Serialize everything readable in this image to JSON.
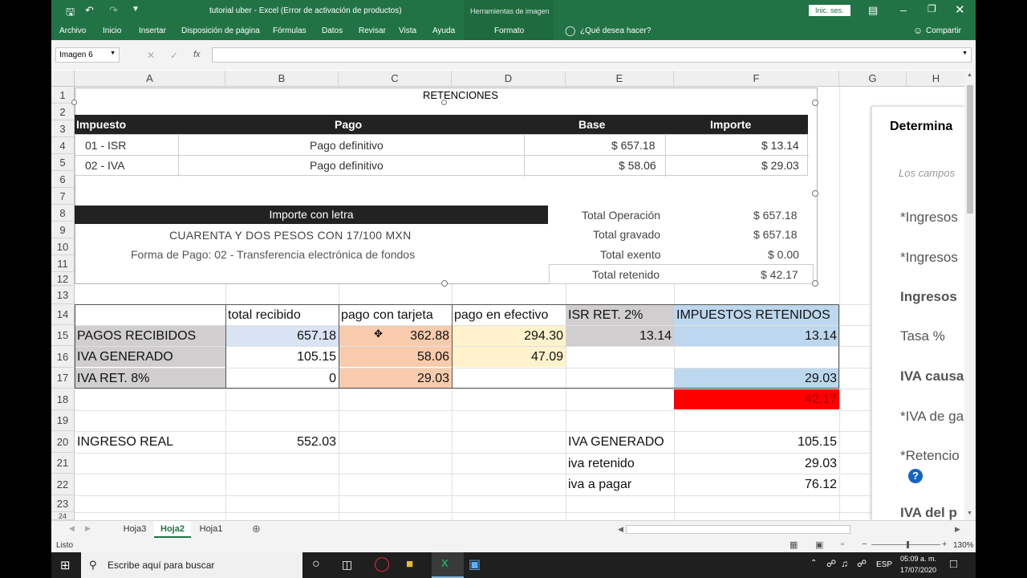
{
  "titlebar": {
    "doc_title": "tutorial uber  -  Excel (Error de activación de productos)",
    "context_tab": "Herramientas de imagen",
    "signin": "Inic. ses."
  },
  "ribbon": {
    "tabs": [
      "Archivo",
      "Inicio",
      "Insertar",
      "Disposición de página",
      "Fórmulas",
      "Datos",
      "Revisar",
      "Vista",
      "Ayuda"
    ],
    "context_tab": "Formato",
    "tell_me": "¿Qué desea hacer?",
    "share": "Compartir"
  },
  "formula_bar": {
    "name_box": "Imagen 6",
    "fx": "fx",
    "value": ""
  },
  "columns": [
    "A",
    "B",
    "C",
    "D",
    "E",
    "F",
    "G",
    "H"
  ],
  "rows": [
    "1",
    "2",
    "3",
    "4",
    "5",
    "6",
    "7",
    "8",
    "9",
    "10",
    "11",
    "12",
    "13",
    "14",
    "15",
    "16",
    "17",
    "18",
    "19",
    "20",
    "21",
    "22",
    "23",
    "24"
  ],
  "retenciones": {
    "title": "RETENCIONES",
    "headers": [
      "Impuesto",
      "Pago",
      "Base",
      "Importe"
    ],
    "rows": [
      [
        "01 - ISR",
        "Pago definitivo",
        "$ 657.18",
        "$ 13.14"
      ],
      [
        "02 - IVA",
        "Pago definitivo",
        "$ 58.06",
        "$ 29.03"
      ]
    ],
    "importe_letra_label": "Importe con letra",
    "importe_letra": "CUARENTA Y DOS PESOS CON 17/100 MXN",
    "forma_pago": "Forma de Pago: 02 - Transferencia electrónica de fondos",
    "totals": [
      [
        "Total Operación",
        "$ 657.18"
      ],
      [
        "Total gravado",
        "$ 657.18"
      ],
      [
        "Total exento",
        "$ 0.00"
      ],
      [
        "Total retenido",
        "$ 42.17"
      ]
    ]
  },
  "table": {
    "headers": [
      "total recibido",
      "pago con tarjeta",
      "pago en efectivo",
      "ISR RET. 2%",
      "IMPUESTOS RETENIDOS"
    ],
    "r15": [
      "PAGOS RECIBIDOS",
      "657.18",
      "362.88",
      "294.30",
      "13.14",
      "13.14"
    ],
    "r16": [
      "IVA GENERADO",
      "105.15",
      "58.06",
      "47.09"
    ],
    "r17": [
      "IVA RET. 8%",
      "0",
      "29.03",
      "29.03"
    ],
    "r18_total": "42.17",
    "r20": [
      "INGRESO REAL",
      "552.03",
      "IVA GENERADO",
      "105.15"
    ],
    "r21": [
      "iva retenido",
      "29.03"
    ],
    "r22": [
      "iva a pagar",
      "76.12"
    ]
  },
  "side_panel": {
    "title": "Determina",
    "note": "Los campos",
    "items": [
      "*Ingresos",
      "*Ingresos",
      "Ingresos",
      "Tasa %",
      "IVA causa",
      "*IVA de ga",
      "*Retencio",
      "IVA del p"
    ]
  },
  "sheets": [
    "Hoja3",
    "Hoja2",
    "Hoja1"
  ],
  "active_sheet": "Hoja2",
  "status": {
    "text": "Listo",
    "zoom": "130%"
  },
  "taskbar": {
    "search": "Escribe aquí para buscar",
    "lang": "ESP",
    "time": "05:09 a. m.",
    "date": "17/07/2020"
  },
  "colors": {
    "excel_green": "#217346",
    "blue": "#dae3f3",
    "orange": "#f8cbad",
    "yellow": "#fff2cc",
    "grey": "#d0cece",
    "red": "#ff0000",
    "light_blue": "#bdd7ee"
  }
}
